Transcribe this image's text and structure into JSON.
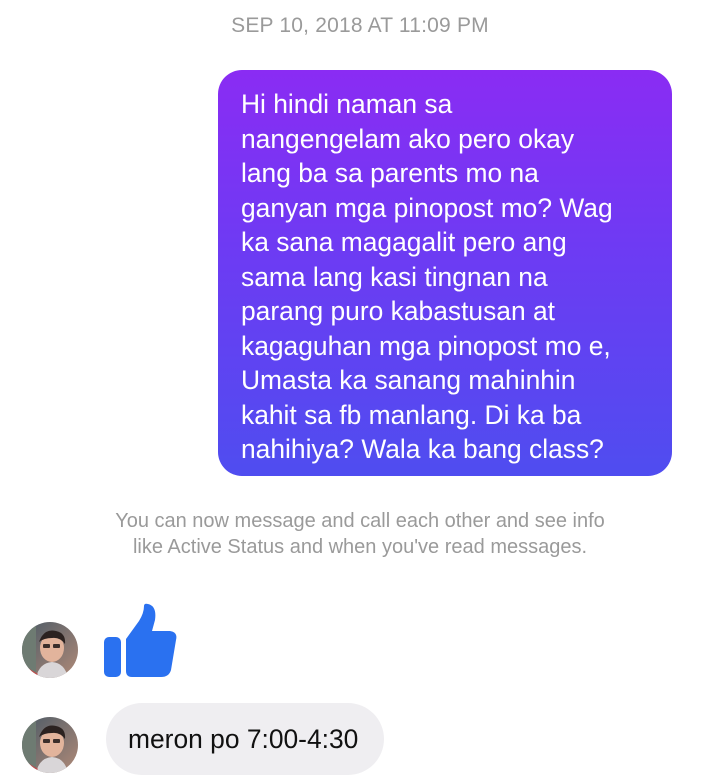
{
  "conversation": {
    "timestamp": "SEP 10, 2018 AT 11:09 PM",
    "sent_message": {
      "lines": [
        "Hi hindi naman sa",
        "nangengelam ako pero okay",
        "lang ba sa parents mo na",
        "ganyan mga pinopost mo? Wag",
        "ka sana magagalit pero ang",
        "sama lang kasi tingnan na",
        "parang puro kabastusan at",
        "kagaguhan mga pinopost mo e,",
        "Umasta ka sanang mahinhin",
        "kahit sa fb manlang. Di ka ba",
        "nahihiya? Wala ka bang class?"
      ]
    },
    "system_notice": "You can now message and call each other and see info like Active Status and when you've read messages.",
    "like_reaction_icon": "thumbs-up-icon",
    "received_message": "meron po 7:00-4:30",
    "contact_avatar_icon": "profile-photo"
  },
  "colors": {
    "sent_gradient_top": "#8a2cf3",
    "sent_gradient_bottom": "#4f4df0",
    "like_blue": "#2a71f0",
    "received_bubble": "#efeef1",
    "meta_text": "#9a9a9a"
  }
}
